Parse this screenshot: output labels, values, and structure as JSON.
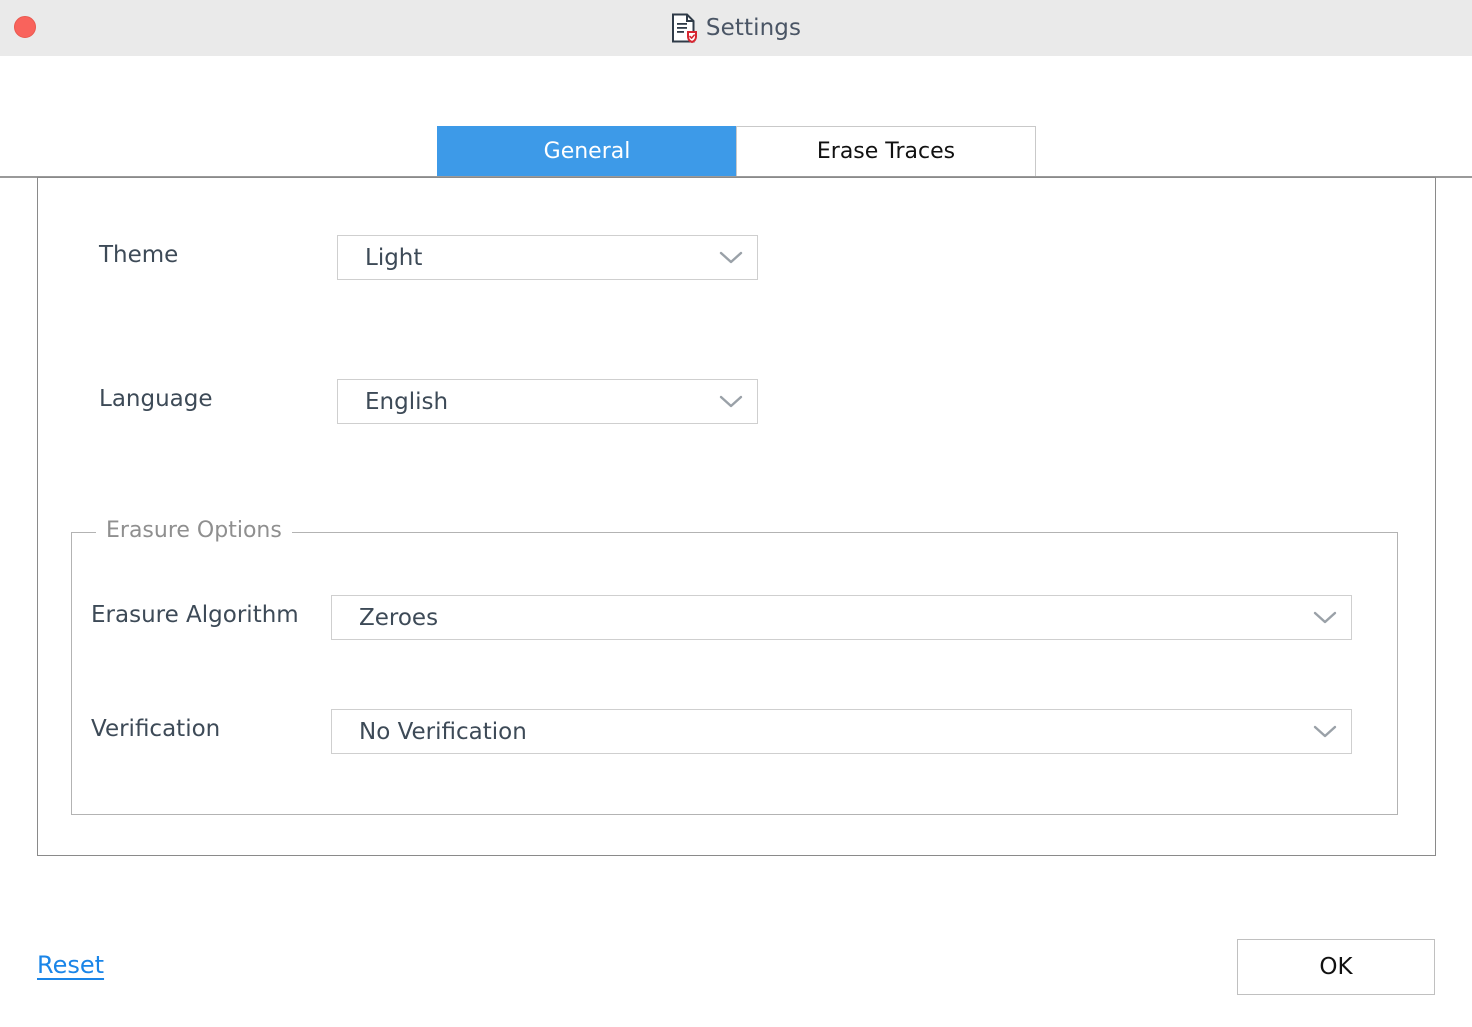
{
  "window": {
    "title": "Settings",
    "icon": "document-shield-icon",
    "close_button": "close-window-button",
    "titlebar_color": "#eaeaea",
    "accent_color": "#3d9ae8",
    "close_color": "#f9635c"
  },
  "tabs": [
    {
      "label": "General",
      "active": true
    },
    {
      "label": "Erase Traces",
      "active": false
    }
  ],
  "general": {
    "theme": {
      "label": "Theme",
      "value": "Light"
    },
    "language": {
      "label": "Language",
      "value": "English"
    },
    "erasure_options": {
      "legend": "Erasure Options",
      "algorithm": {
        "label": "Erasure Algorithm",
        "value": "Zeroes"
      },
      "verification": {
        "label": "Verification",
        "value": "No Verification"
      }
    }
  },
  "footer": {
    "reset_label": "Reset",
    "reset_color": "#1a85e8",
    "ok_label": "OK"
  }
}
